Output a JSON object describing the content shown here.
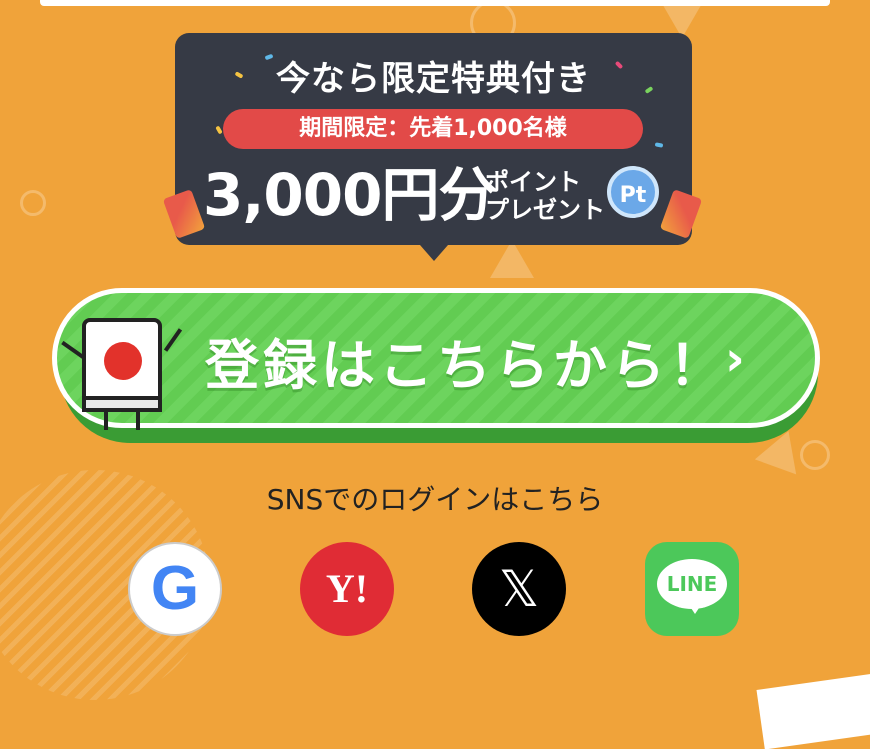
{
  "promo": {
    "title": "今なら限定特典付き",
    "tag": "期間限定：先着1,000名様",
    "amount": "3,000円分",
    "sub_line1": "ポイント",
    "sub_line2": "プレゼント",
    "badge": "Pt"
  },
  "register": {
    "label": "登録はこちらから！",
    "arrow": "›"
  },
  "sns": {
    "heading": "SNSでのログインはこちら",
    "providers": [
      {
        "name": "Google",
        "glyph": "G",
        "color": "#4285f4"
      },
      {
        "name": "Yahoo!",
        "glyph": "Y!",
        "color": "#e02c35"
      },
      {
        "name": "X",
        "glyph": "𝕏",
        "color": "#000000"
      },
      {
        "name": "LINE",
        "glyph": "LINE",
        "color": "#4cc85a"
      }
    ]
  },
  "footer_peek": ""
}
